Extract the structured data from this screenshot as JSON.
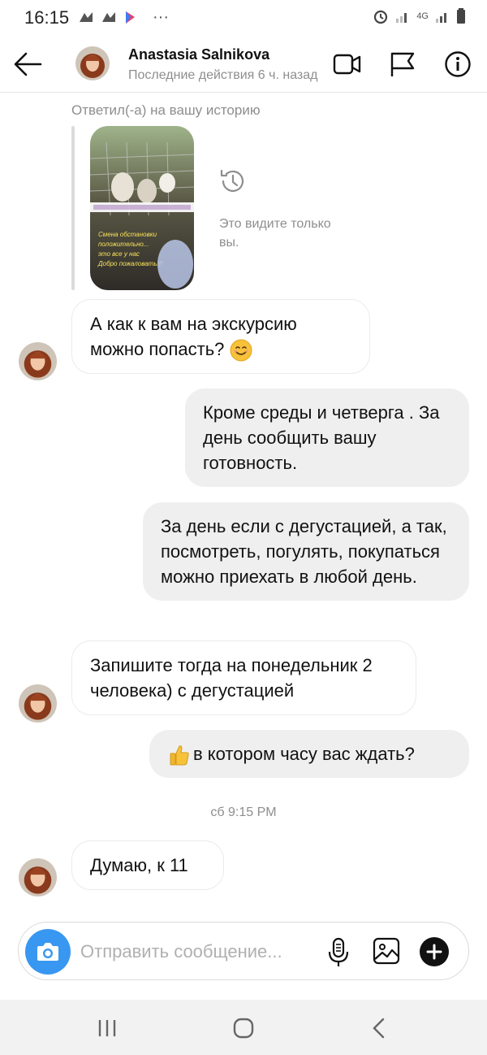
{
  "status_bar": {
    "time": "16:15",
    "dots": "···",
    "network_label": "4G"
  },
  "header": {
    "name": "Anastasia  Salnikova",
    "status": "Последние действия 6 ч. назад"
  },
  "story": {
    "label": "Ответил(-а) на вашу историю",
    "visibility_text": "Это видите только вы.",
    "thumb_caption": "Смена обстановки положительно... это все у нас... Добро пожаловать!!!"
  },
  "messages": [
    {
      "text": "А как к вам на экскурсию можно попасть?",
      "emoji": "smiling-face"
    },
    {
      "text": "Кроме среды и четверга . За день сообщить вашу готовность."
    },
    {
      "text": "За день если  с дегустацией, а так, посмотреть, погулять, покупаться можно приехать в любой день."
    },
    {
      "text": "Запишите тогда на понедельник 2 человека) с дегустацией"
    },
    {
      "text": "в котором часу вас ждать?",
      "emoji": "thumbs-up"
    },
    {
      "text": "Думаю, к 11"
    }
  ],
  "timestamp": "сб 9:15 PM",
  "composer": {
    "placeholder": "Отправить сообщение..."
  },
  "colors": {
    "camera_button": "#3897f0",
    "outgoing_bubble": "#efefef",
    "secondary_text": "#8e8e8e"
  }
}
